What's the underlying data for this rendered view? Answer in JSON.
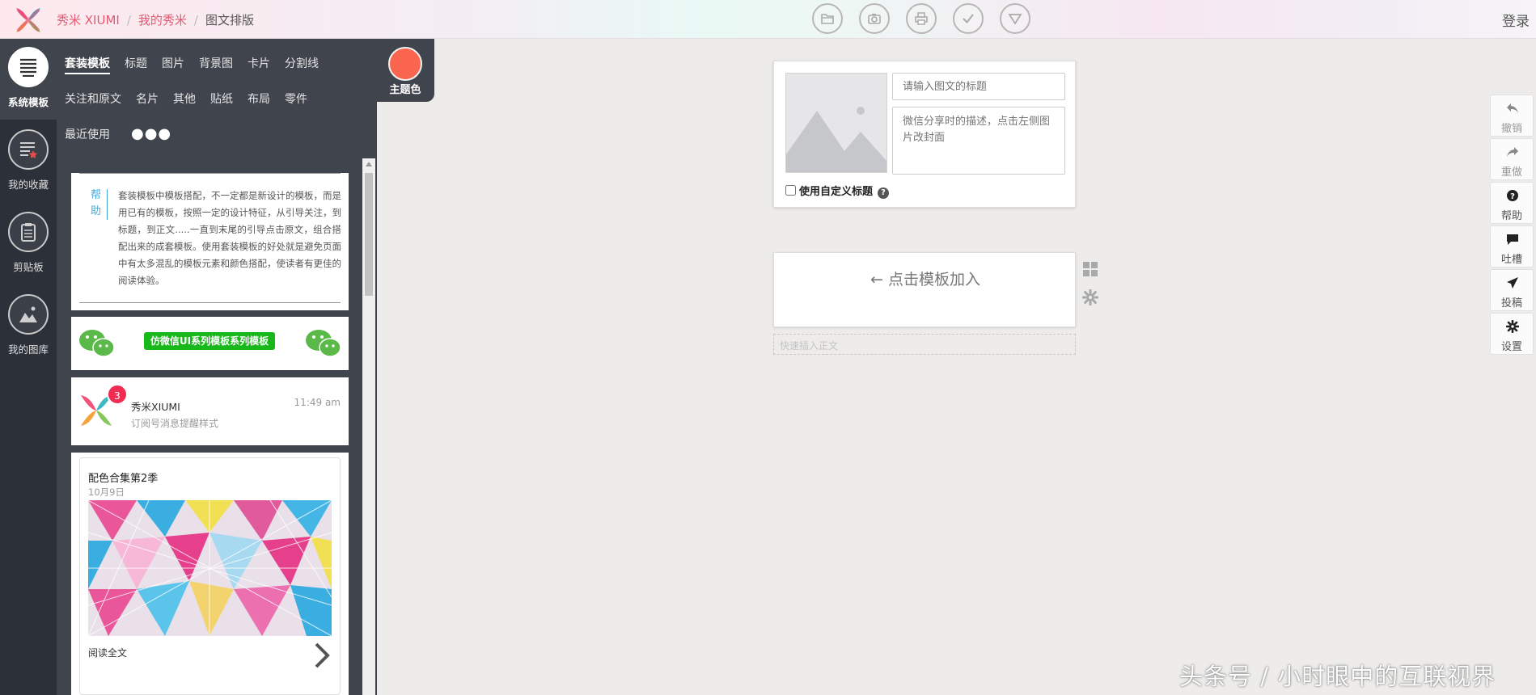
{
  "header": {
    "breadcrumb": {
      "brand": "秀米 XIUMI",
      "sep": "/",
      "link": "我的秀米",
      "current": "图文排版"
    },
    "toolbar": [
      "folder-icon",
      "camera-icon",
      "print-icon",
      "check-icon",
      "triangle-down-icon"
    ],
    "login": "登录"
  },
  "leftnav": [
    {
      "label": "系统模板",
      "icon": "list-icon",
      "active": true
    },
    {
      "label": "我的收藏",
      "icon": "favorite-list-icon",
      "active": false
    },
    {
      "label": "剪贴板",
      "icon": "clipboard-icon",
      "active": false
    },
    {
      "label": "我的图库",
      "icon": "image-library-icon",
      "active": false
    }
  ],
  "categories": {
    "row1": [
      "套装模板",
      "标题",
      "图片",
      "背景图",
      "卡片",
      "分割线"
    ],
    "row2": [
      "关注和原文",
      "名片",
      "其他",
      "贴纸",
      "布局",
      "零件"
    ],
    "row3": [
      "最近使用"
    ],
    "more": "●●●",
    "active": "套装模板"
  },
  "theme": {
    "label": "主题色",
    "color": "#fa6550"
  },
  "templates": {
    "help": {
      "tag": "帮助",
      "text": "套装模板中模板搭配，不一定都是新设计的模板，而是用已有的模板，按照一定的设计特征，从引导关注，到标题，到正文.....一直到末尾的引导点击原文，组合搭配出来的成套模板。使用套装模板的好处就是避免页面中有太多混乱的模板元素和颜色搭配，使读者有更佳的阅读体验。"
    },
    "wechat_ui": {
      "title": "仿微信UI系列模板系列模板"
    },
    "message": {
      "badge": "3",
      "sender": "秀米XIUMI",
      "time": "11:49 am",
      "sub": "订阅号消息提醒样式"
    },
    "article": {
      "title": "配色合集第2季",
      "date": "10月9日",
      "read_more": "阅读全文"
    }
  },
  "editor": {
    "title_placeholder": "请输入图文的标题",
    "desc_placeholder": "微信分享时的描述，点击左侧图片改封面",
    "custom_title": "使用自定义标题",
    "help_mark": "?",
    "add_hint": "← 点击模板加入",
    "quick_insert": "快速插入正文"
  },
  "right_tools": [
    {
      "label": "撤销",
      "icon": "undo-icon",
      "muted": true
    },
    {
      "label": "重做",
      "icon": "redo-icon",
      "muted": true
    },
    {
      "label": "帮助",
      "icon": "help-icon",
      "muted": false
    },
    {
      "label": "吐槽",
      "icon": "comment-icon",
      "muted": false
    },
    {
      "label": "投稿",
      "icon": "send-icon",
      "muted": false
    },
    {
      "label": "设置",
      "icon": "settings-icon",
      "muted": false
    }
  ],
  "watermark": "头条号 / 小时眼中的互联视界"
}
